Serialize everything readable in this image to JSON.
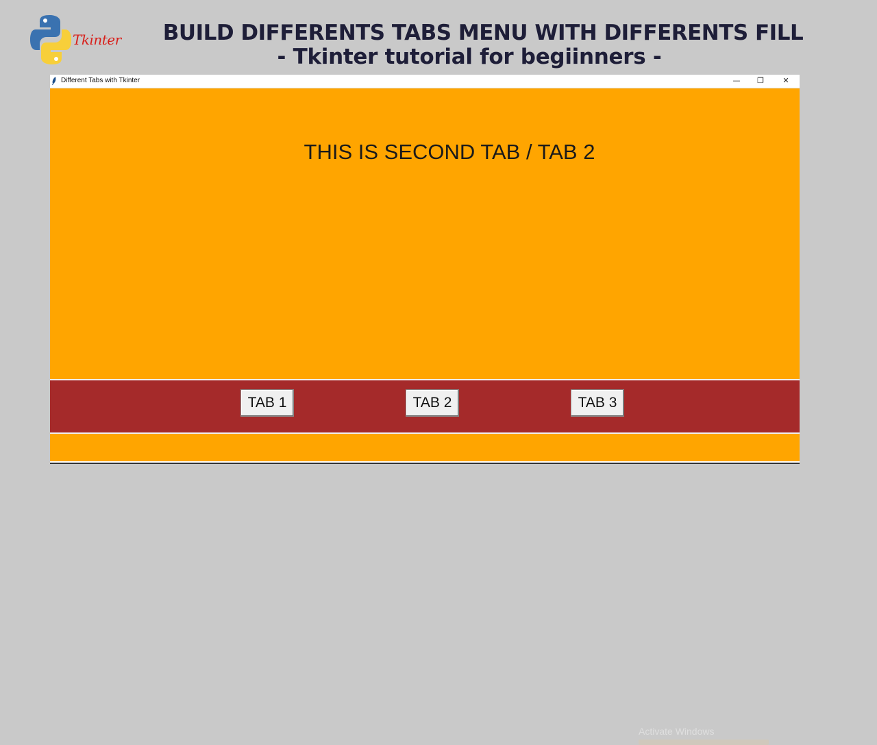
{
  "header": {
    "logo_text": "Tkinter",
    "title_line1": "BUILD DIFFERENTS TABS MENU WITH DIFFERENTS FILL",
    "title_line2": "- Tkinter tutorial for begiinners -"
  },
  "window": {
    "title": "Different Tabs with Tkinter",
    "controls": {
      "minimize": "—",
      "maximize": "❐",
      "close": "✕"
    },
    "content_bg": "#ffa500",
    "tabbar_bg": "#a52a2a",
    "main_text": "THIS IS SECOND TAB / TAB 2",
    "tabs": [
      {
        "label": "TAB 1"
      },
      {
        "label": "TAB 2"
      },
      {
        "label": "TAB 3"
      }
    ]
  },
  "watermark": {
    "text": "Activate Windows"
  }
}
